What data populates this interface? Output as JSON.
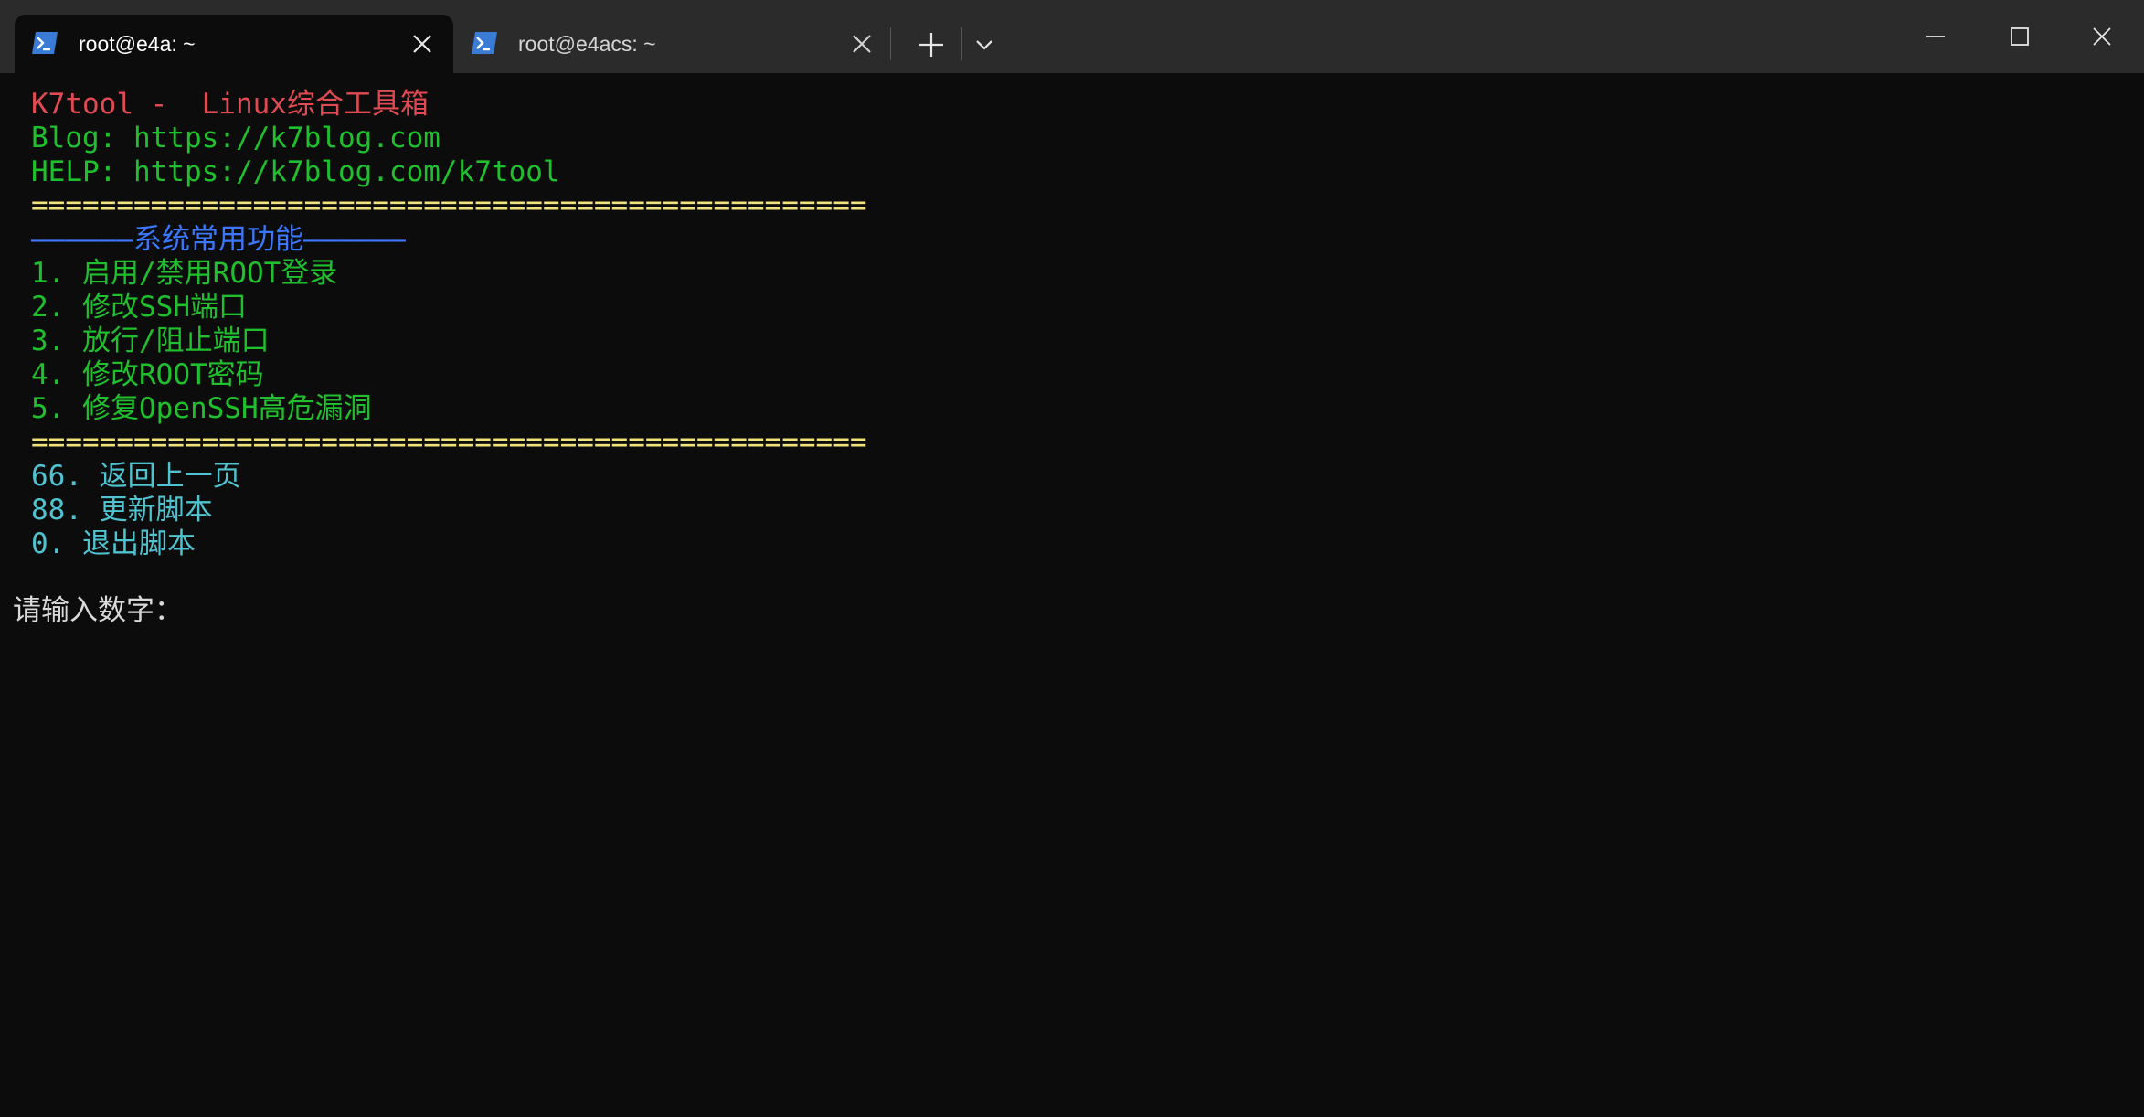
{
  "tabs": [
    {
      "title": "root@e4a: ~",
      "active": true
    },
    {
      "title": "root@e4acs: ~",
      "active": false
    }
  ],
  "icons": {
    "tab_icon": "powershell-icon",
    "close": "close-icon",
    "new_tab": "plus-icon",
    "dropdown": "chevron-down-icon",
    "minimize": "minimize-icon",
    "maximize": "maximize-icon",
    "window_close": "close-icon"
  },
  "colors": {
    "title": "#e04a52",
    "info": "#1fbf2d",
    "separator": "#f2e27a",
    "section": "#3b78ff",
    "nav": "#4fc3cf",
    "prompt": "#d9d9d9",
    "background": "#0c0c0c"
  },
  "terminal": {
    "title_line": "K7tool -  Linux综合工具箱",
    "blog_line": "Blog: https://k7blog.com",
    "help_line": "HELP: https://k7blog.com/k7tool",
    "separator_top": "=================================================",
    "section_header": "——————系统常用功能——————",
    "menu_items": [
      "1. 启用/禁用ROOT登录",
      "2. 修改SSH端口",
      "3. 放行/阻止端口",
      "4. 修改ROOT密码",
      "5. 修复OpenSSH高危漏洞"
    ],
    "separator_bottom": "=================================================",
    "nav_items": [
      "66. 返回上一页",
      "88. 更新脚本",
      "0. 退出脚本"
    ],
    "prompt": "请输入数字："
  }
}
